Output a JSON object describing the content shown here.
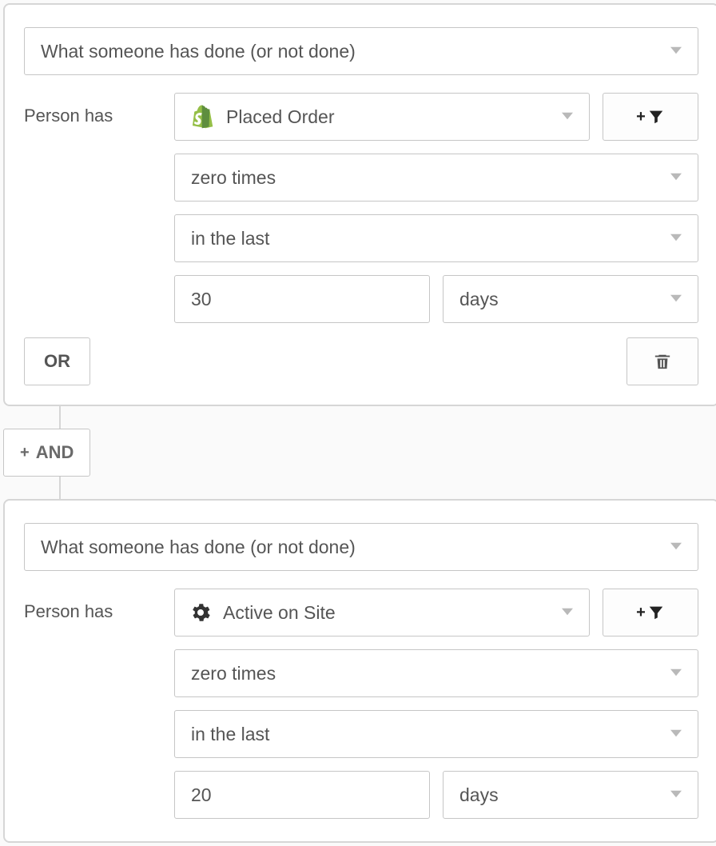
{
  "groups": [
    {
      "conditionType": "What someone has done (or not done)",
      "personLabel": "Person has",
      "metric": {
        "iconType": "shopify",
        "label": "Placed Order"
      },
      "frequency": "zero times",
      "timeframe": "in the last",
      "number": "30",
      "unit": "days",
      "orLabel": "OR"
    },
    {
      "conditionType": "What someone has done (or not done)",
      "personLabel": "Person has",
      "metric": {
        "iconType": "gear",
        "label": "Active on Site"
      },
      "frequency": "zero times",
      "timeframe": "in the last",
      "number": "20",
      "unit": "days"
    }
  ],
  "andLabel": "AND"
}
